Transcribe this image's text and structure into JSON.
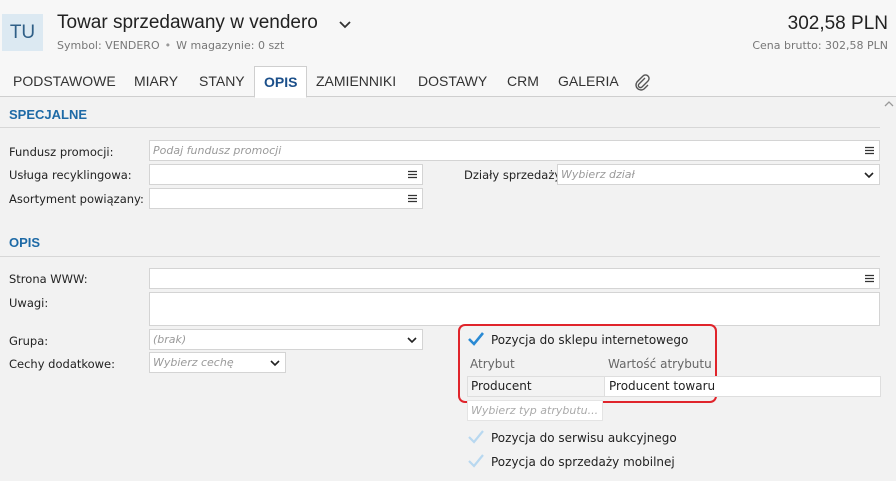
{
  "header": {
    "avatar_text": "TU",
    "title": "Towar sprzedawany w vendero",
    "symbol": "Symbol: VENDERO",
    "stock": "W magazynie: 0 szt",
    "price": "302,58 PLN",
    "price_note": "Cena brutto: 302,58 PLN"
  },
  "tabs": [
    {
      "label": "PODSTAWOWE"
    },
    {
      "label": "MIARY"
    },
    {
      "label": "STANY"
    },
    {
      "label": "OPIS"
    },
    {
      "label": "ZAMIENNIKI"
    },
    {
      "label": "DOSTAWY"
    },
    {
      "label": "CRM"
    },
    {
      "label": "GALERIA"
    }
  ],
  "active_tab": "OPIS",
  "icons": {
    "title_dropdown": "chevron-down-icon",
    "attachments": "paperclip-icon",
    "list_picker": "list-icon",
    "dropdown": "chevron-down-icon",
    "checkbox": "checkmark-icon",
    "scroll": "chevron-up-icon"
  },
  "colors": {
    "accent": "#1e6aa6",
    "active_tab_text": "#1b4f8a",
    "highlight_border": "#e0242b",
    "checkbox_checked": "#2a8ad4",
    "checkbox_unchecked": "#b8d8f0"
  },
  "specjalne": {
    "title": "SPECJALNE",
    "fundusz_label": "Fundusz promocji:",
    "fundusz_placeholder": "Podaj fundusz promocji",
    "recykling_label": "Usługa recyklingowa:",
    "dzialy_label": "Działy sprzedaży:",
    "dzialy_placeholder": "Wybierz dział",
    "asortyment_label": "Asortyment powiązany:"
  },
  "opis": {
    "title": "OPIS",
    "www_label": "Strona WWW:",
    "uwagi_label": "Uwagi:",
    "grupa_label": "Grupa:",
    "grupa_value": "(brak)",
    "cechy_label": "Cechy dodatkowe:",
    "cechy_placeholder": "Wybierz cechę"
  },
  "sklep": {
    "checkbox_label": "Pozycja do sklepu internetowego",
    "checked": true,
    "col_attr": "Atrybut",
    "col_value": "Wartość atrybutu",
    "rows": [
      {
        "attr": "Producent",
        "value": "Producent towaru"
      }
    ],
    "add_placeholder": "Wybierz typ atrybutu..."
  },
  "aukcje": {
    "checkbox_label": "Pozycja do serwisu aukcyjnego",
    "checked": false
  },
  "mobilne": {
    "checkbox_label": "Pozycja do sprzedaży mobilnej",
    "checked": false
  }
}
